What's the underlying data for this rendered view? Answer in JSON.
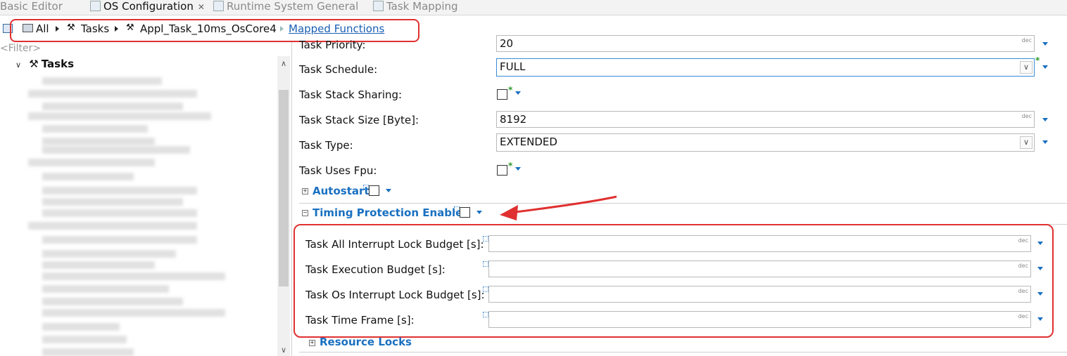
{
  "tabs": [
    {
      "label": "Basic Editor",
      "active": false
    },
    {
      "label": "OS Configuration",
      "active": true
    },
    {
      "label": "Runtime System General",
      "active": false
    },
    {
      "label": "Task Mapping",
      "active": false
    }
  ],
  "breadcrumb": {
    "all": "All",
    "tasks": "Tasks",
    "task": "Appl_Task_10ms_OsCore4",
    "link": "Mapped Functions"
  },
  "left": {
    "filter": "<Filter>",
    "tree_root": "Tasks"
  },
  "props": {
    "priority": {
      "label": "Task Priority:",
      "value": "20",
      "unit": "dec"
    },
    "schedule": {
      "label": "Task Schedule:",
      "value": "FULL"
    },
    "stack_sharing": {
      "label": "Task Stack Sharing:"
    },
    "stack_size": {
      "label": "Task Stack Size [Byte]:",
      "value": "8192",
      "unit": "dec"
    },
    "type": {
      "label": "Task Type:",
      "value": "EXTENDED"
    },
    "uses_fpu": {
      "label": "Task Uses Fpu:"
    }
  },
  "sections": {
    "autostart": "Autostart",
    "timing": "Timing Protection Enabled",
    "resource": "Resource Locks"
  },
  "timing_fields": [
    {
      "label": "Task All Interrupt Lock Budget [s]:",
      "unit": "dec"
    },
    {
      "label": "Task Execution Budget [s]:",
      "unit": "dec"
    },
    {
      "label": "Task Os Interrupt Lock Budget [s]:",
      "unit": "dec"
    },
    {
      "label": "Task Time Frame [s]:",
      "unit": "dec"
    }
  ],
  "colors": {
    "annotation": "#e03030",
    "section": "#1a70c0",
    "link": "#1a5fb4"
  }
}
